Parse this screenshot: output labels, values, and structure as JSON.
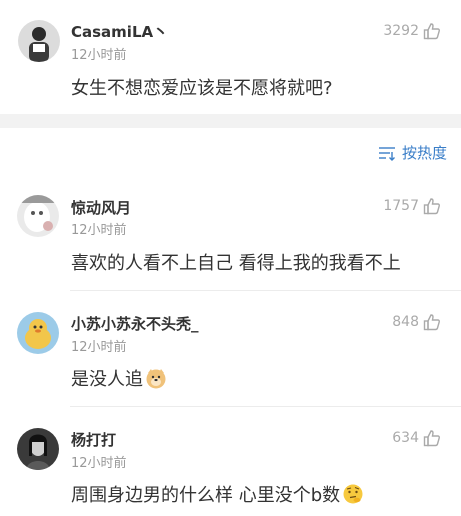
{
  "post": {
    "username": "CasamiLA丶",
    "time": "12小时前",
    "likes": "3292",
    "content": "女生不想恋爱应该是不愿将就吧?"
  },
  "sort": {
    "label": "按热度",
    "icon": "sort-icon"
  },
  "comments": [
    {
      "username": "惊动风月",
      "time": "12小时前",
      "likes": "1757",
      "content": "喜欢的人看不上自己 看得上我的我看不上"
    },
    {
      "username": "小苏小苏永不头秃_",
      "time": "12小时前",
      "likes": "848",
      "content": "是没人追",
      "emoji": "doge-emoji"
    },
    {
      "username": "杨打打",
      "time": "12小时前",
      "likes": "634",
      "content": "周围身边男的什么样 心里没个b数",
      "emoji": "thinking-emoji"
    }
  ],
  "colors": {
    "accent": "#3a7ec8",
    "muted": "#999999",
    "separator": "#f2f2f2"
  }
}
